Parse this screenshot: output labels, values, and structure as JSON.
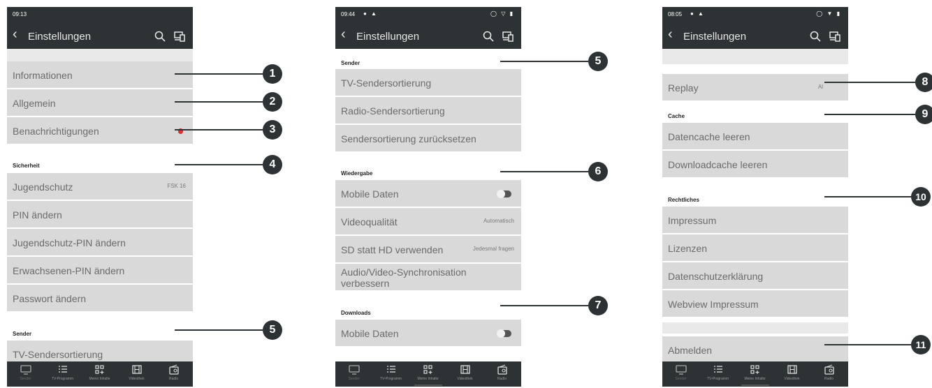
{
  "phones": [
    {
      "time": "09:13",
      "title": "Einstellungen",
      "rows": {
        "informationen": "Informationen",
        "allgemein": "Allgemein",
        "benachrichtigungen": "Benachrichtigungen",
        "jugendschutz": "Jugendschutz",
        "jugendschutz_value": "FSK 16",
        "pin": "PIN ändern",
        "jugendschutz_pin": "Jugendschutz-PIN ändern",
        "erwachsenen_pin": "Erwachsenen-PIN ändern",
        "passwort": "Passwort ändern",
        "tv_sortierung": "TV-Sendersortierung"
      },
      "sections": {
        "sicherheit": "Sicherheit",
        "sender": "Sender"
      }
    },
    {
      "time": "09:44",
      "title": "Einstellungen",
      "rows": {
        "tv_sortierung": "TV-Sendersortierung",
        "radio_sortierung": "Radio-Sendersortierung",
        "zuruecksetzen": "Sendersortierung zurücksetzen",
        "mobile_daten": "Mobile Daten",
        "videoqualitaet": "Videoqualität",
        "videoqualitaet_value": "Automatisch",
        "sd_hd": "SD statt HD verwenden",
        "sd_hd_value": "Jedesmal fragen",
        "sync": "Audio/Video-Synchronisation verbessern",
        "dl_mobile_daten": "Mobile Daten"
      },
      "sections": {
        "sender": "Sender",
        "wiedergabe": "Wiedergabe",
        "downloads": "Downloads"
      }
    },
    {
      "time": "08:05",
      "title": "Einstellungen",
      "rows": {
        "replay": "Replay",
        "replay_value": "Al",
        "datencache": "Datencache leeren",
        "downloadcache": "Downloadcache leeren",
        "impressum": "Impressum",
        "lizenzen": "Lizenzen",
        "datenschutz": "Datenschutzerklärung",
        "webview": "Webview Impressum",
        "abmelden": "Abmelden"
      },
      "sections": {
        "cache": "Cache",
        "rechtliches": "Rechtliches"
      }
    }
  ],
  "nav": {
    "sender": "Sender",
    "tv_programm": "TV-Programm",
    "meine_inhalte": "Meine Inhalte",
    "videothek": "Videothek",
    "radio": "Radio"
  },
  "callouts": {
    "c1": "1",
    "c2": "2",
    "c3": "3",
    "c4": "4",
    "c5a": "5",
    "c5b": "5",
    "c6": "6",
    "c7": "7",
    "c8": "8",
    "c9": "9",
    "c10": "10",
    "c11": "11"
  },
  "colors": {
    "bar": "#2d3235",
    "row": "#d9d9d9",
    "badge": "#e03030",
    "callout": "#2d3235"
  },
  "icons": {
    "back": "chevron-left-icon",
    "search": "search-icon",
    "cast": "cast-device-icon",
    "nav_sender": "tv-icon",
    "nav_tv_programm": "list-icon",
    "nav_meine_inhalte": "grid-plus-icon",
    "nav_videothek": "film-icon",
    "nav_radio": "radio-icon"
  }
}
